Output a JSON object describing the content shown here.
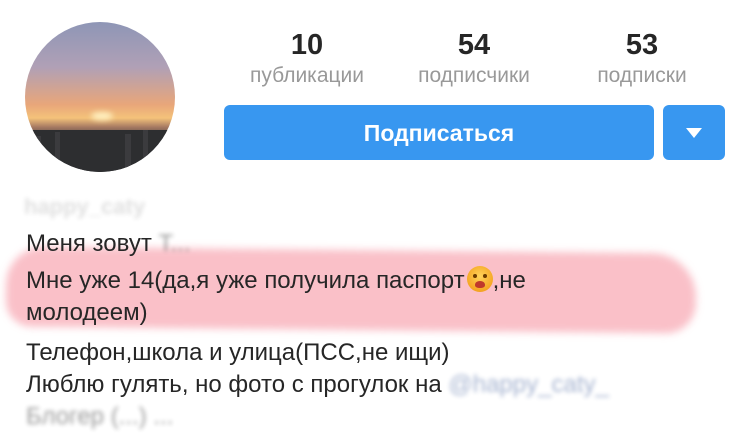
{
  "stats": [
    {
      "value": "10",
      "label": "публикации"
    },
    {
      "value": "54",
      "label": "подписчики"
    },
    {
      "value": "53",
      "label": "подписки"
    }
  ],
  "actions": {
    "follow_label": "Подписаться",
    "dropdown_icon": "chevron-down-icon"
  },
  "profile": {
    "username": "happy_caty"
  },
  "bio": {
    "line1_visible": "Меня зовут",
    "line1_blurred": "Т...",
    "line2_before": "Мне уже 14(да,я уже получила паспорт",
    "line2_after": ",не",
    "emoji_icon": "crying-face-icon",
    "line3": "молодеем)",
    "line4": "Телефон,школа и улица(ПСС,не ищи)",
    "line5_before": "Люблю гулять, но фото с прогулок на ",
    "line5_mention": "@happy_caty_",
    "line6": "Блогер (...) ..."
  },
  "colors": {
    "accent": "#3897f0",
    "highlight": "#f4687c"
  }
}
